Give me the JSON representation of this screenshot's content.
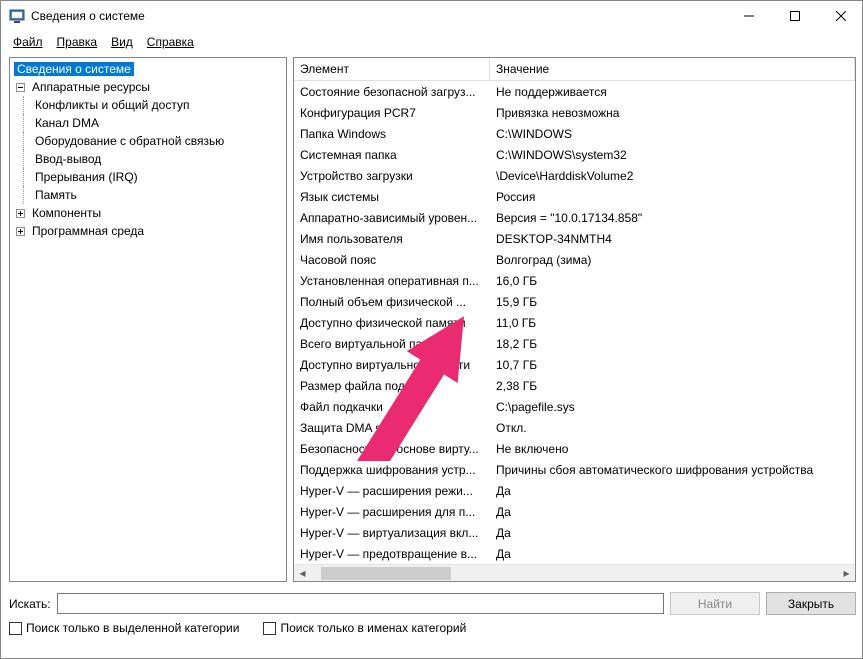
{
  "window": {
    "title": "Сведения о системе"
  },
  "menu": {
    "file": "Файл",
    "edit": "Правка",
    "view": "Вид",
    "help": "Справка"
  },
  "tree": {
    "root": "Сведения о системе",
    "hw": "Аппаратные ресурсы",
    "hw_children": [
      "Конфликты и общий доступ",
      "Канал DMA",
      "Оборудование с обратной связью",
      "Ввод-вывод",
      "Прерывания (IRQ)",
      "Память"
    ],
    "components": "Компоненты",
    "software_env": "Программная среда"
  },
  "list": {
    "col_element": "Элемент",
    "col_value": "Значение",
    "rows": [
      {
        "k": "Состояние безопасной загруз...",
        "v": "Не поддерживается"
      },
      {
        "k": "Конфигурация PCR7",
        "v": "Привязка невозможна"
      },
      {
        "k": "Папка Windows",
        "v": "C:\\WINDOWS"
      },
      {
        "k": "Системная папка",
        "v": "C:\\WINDOWS\\system32"
      },
      {
        "k": "Устройство загрузки",
        "v": "\\Device\\HarddiskVolume2"
      },
      {
        "k": "Язык системы",
        "v": "Россия"
      },
      {
        "k": "Аппаратно-зависимый уровен...",
        "v": "Версия = \"10.0.17134.858\""
      },
      {
        "k": "Имя пользователя",
        "v": "DESKTOP-34NMTH4"
      },
      {
        "k": "Часовой пояс",
        "v": "Волгоград (зима)"
      },
      {
        "k": "Установленная оперативная п...",
        "v": "16,0 ГБ"
      },
      {
        "k": "Полный объем физической ...",
        "v": "15,9 ГБ"
      },
      {
        "k": "Доступно физической памяти",
        "v": "11,0 ГБ"
      },
      {
        "k": "Всего виртуальной памяти",
        "v": "18,2 ГБ"
      },
      {
        "k": "Доступно виртуальной памяти",
        "v": "10,7 ГБ"
      },
      {
        "k": "Размер файла подкачки",
        "v": "2,38 ГБ"
      },
      {
        "k": "Файл подкачки",
        "v": "C:\\pagefile.sys"
      },
      {
        "k": "Защита DMA ядра",
        "v": "Откл."
      },
      {
        "k": "Безопасность на основе вирту...",
        "v": "Не включено"
      },
      {
        "k": "Поддержка шифрования устр...",
        "v": "Причины сбоя автоматического шифрования устройства"
      },
      {
        "k": "Hyper-V — расширения режи...",
        "v": "Да"
      },
      {
        "k": "Hyper-V — расширения для п...",
        "v": "Да"
      },
      {
        "k": "Hyper-V — виртуализация вкл...",
        "v": "Да"
      },
      {
        "k": "Hyper-V — предотвращение в...",
        "v": "Да"
      }
    ]
  },
  "search": {
    "label": "Искать:",
    "find_btn": "Найти",
    "close_btn": "Закрыть",
    "chk_selected": "Поиск только в выделенной категории",
    "chk_names": "Поиск только в именах категорий"
  },
  "arrow": {
    "color": "#ea2b72"
  }
}
